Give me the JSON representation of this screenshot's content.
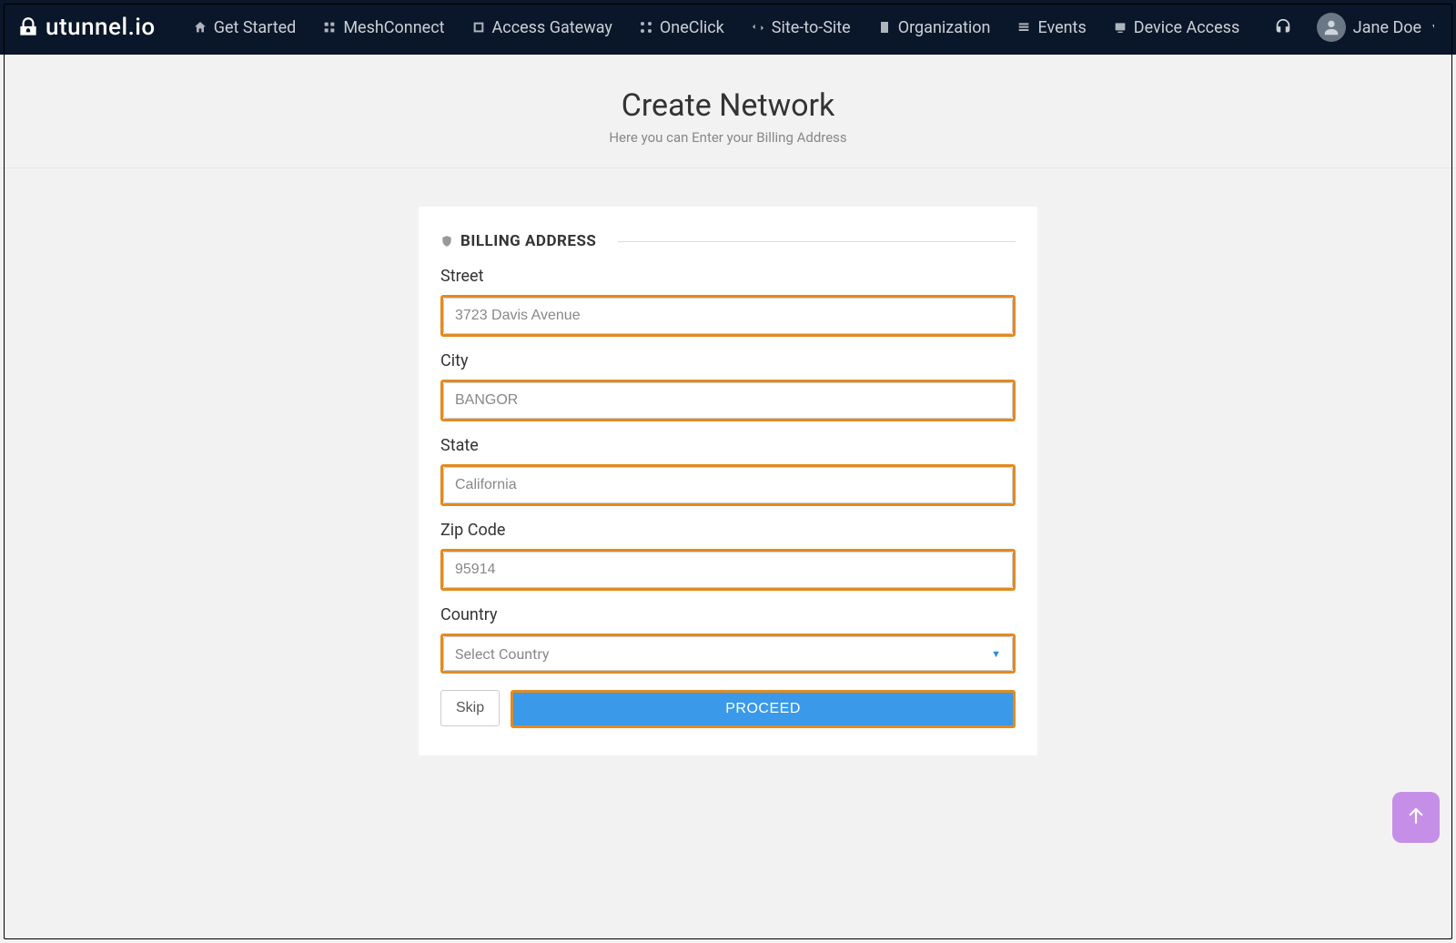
{
  "brand": {
    "name": "utunnel.io"
  },
  "nav": {
    "items": [
      {
        "label": "Get Started"
      },
      {
        "label": "MeshConnect"
      },
      {
        "label": "Access Gateway"
      },
      {
        "label": "OneClick"
      },
      {
        "label": "Site-to-Site"
      },
      {
        "label": "Organization"
      },
      {
        "label": "Events"
      },
      {
        "label": "Device Access"
      }
    ]
  },
  "user": {
    "name": "Jane Doe"
  },
  "page": {
    "title": "Create Network",
    "subtitle": "Here you can Enter your Billing Address"
  },
  "form": {
    "section_title": "BILLING ADDRESS",
    "street": {
      "label": "Street",
      "value": "3723 Davis Avenue"
    },
    "city": {
      "label": "City",
      "value": "BANGOR"
    },
    "state": {
      "label": "State",
      "value": "California"
    },
    "zip": {
      "label": "Zip Code",
      "value": "95914"
    },
    "country": {
      "label": "Country",
      "placeholder": "Select Country"
    },
    "skip_label": "Skip",
    "proceed_label": "PROCEED"
  }
}
